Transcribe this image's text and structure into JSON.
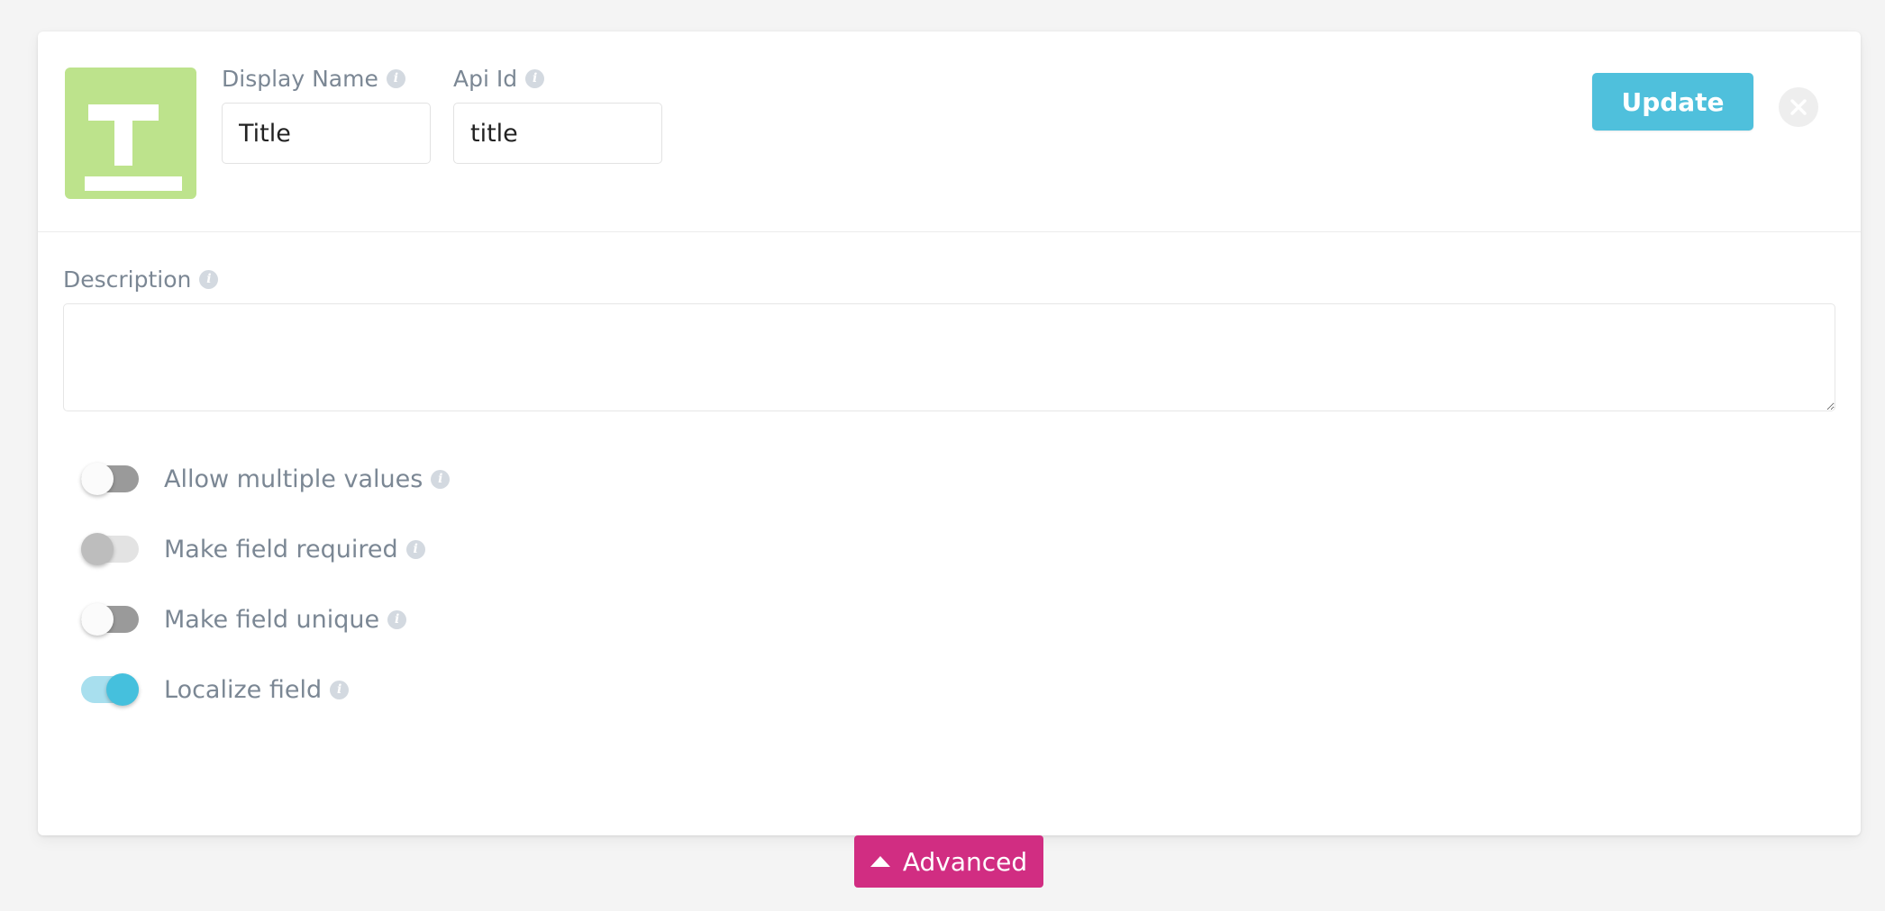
{
  "field_editor": {
    "type_icon": {
      "glyph": "T",
      "name": "text-type-icon",
      "color": "#bde38c"
    },
    "display_name": {
      "label": "Display Name",
      "value": "Title",
      "placeholder": "",
      "info_glyph": "i"
    },
    "api_id": {
      "label": "Api Id",
      "value": "title",
      "placeholder": "",
      "info_glyph": "i"
    },
    "update_button": {
      "label": "Update",
      "color": "#4fc0dc"
    },
    "close_button": {
      "label": "",
      "color": "#eeeeee"
    },
    "description": {
      "label": "Description",
      "value": "",
      "placeholder": "",
      "info_glyph": "i"
    },
    "toggles": [
      {
        "label": "Allow multiple values",
        "state": "off",
        "disabled": false,
        "info_glyph": "i"
      },
      {
        "label": "Make field required",
        "state": "off",
        "disabled": true,
        "info_glyph": "i"
      },
      {
        "label": "Make field unique",
        "state": "off",
        "disabled": false,
        "info_glyph": "i"
      },
      {
        "label": "Localize field",
        "state": "on",
        "disabled": false,
        "info_glyph": "i"
      }
    ],
    "advanced_button": {
      "label": "Advanced",
      "color": "#d12d82",
      "caret": "up"
    }
  }
}
